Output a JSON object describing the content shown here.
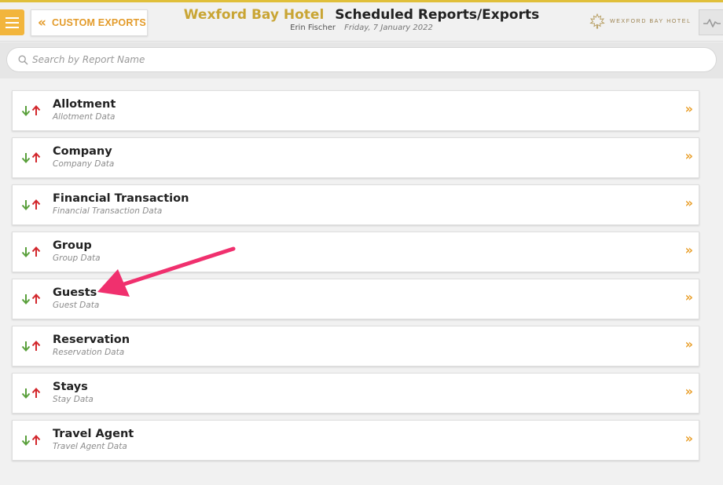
{
  "header": {
    "back_label": "CUSTOM EXPORTS",
    "hotel_name": "Wexford Bay Hotel",
    "page_title": "Scheduled Reports/Exports",
    "user_name": "Erin Fischer",
    "date": "Friday, 7 January 2022",
    "logo_text": "WEXFORD BAY HOTEL"
  },
  "search": {
    "placeholder": "Search by Report Name",
    "value": ""
  },
  "reports": [
    {
      "title": "Allotment",
      "subtitle": "Allotment Data"
    },
    {
      "title": "Company",
      "subtitle": "Company Data"
    },
    {
      "title": "Financial Transaction",
      "subtitle": "Financial Transaction Data"
    },
    {
      "title": "Group",
      "subtitle": "Group Data"
    },
    {
      "title": "Guests",
      "subtitle": "Guest Data"
    },
    {
      "title": "Reservation",
      "subtitle": "Reservation Data"
    },
    {
      "title": "Stays",
      "subtitle": "Stay Data"
    },
    {
      "title": "Travel Agent",
      "subtitle": "Travel Agent Data"
    }
  ],
  "icons": {
    "row_chevron": "»",
    "back_chevron": "«"
  },
  "colors": {
    "accent": "#e9a02d",
    "hotel_gold": "#c9a534",
    "arrow_down_green": "#5aa03c",
    "arrow_up_red": "#d2262b",
    "annotation": "#f0306e"
  }
}
